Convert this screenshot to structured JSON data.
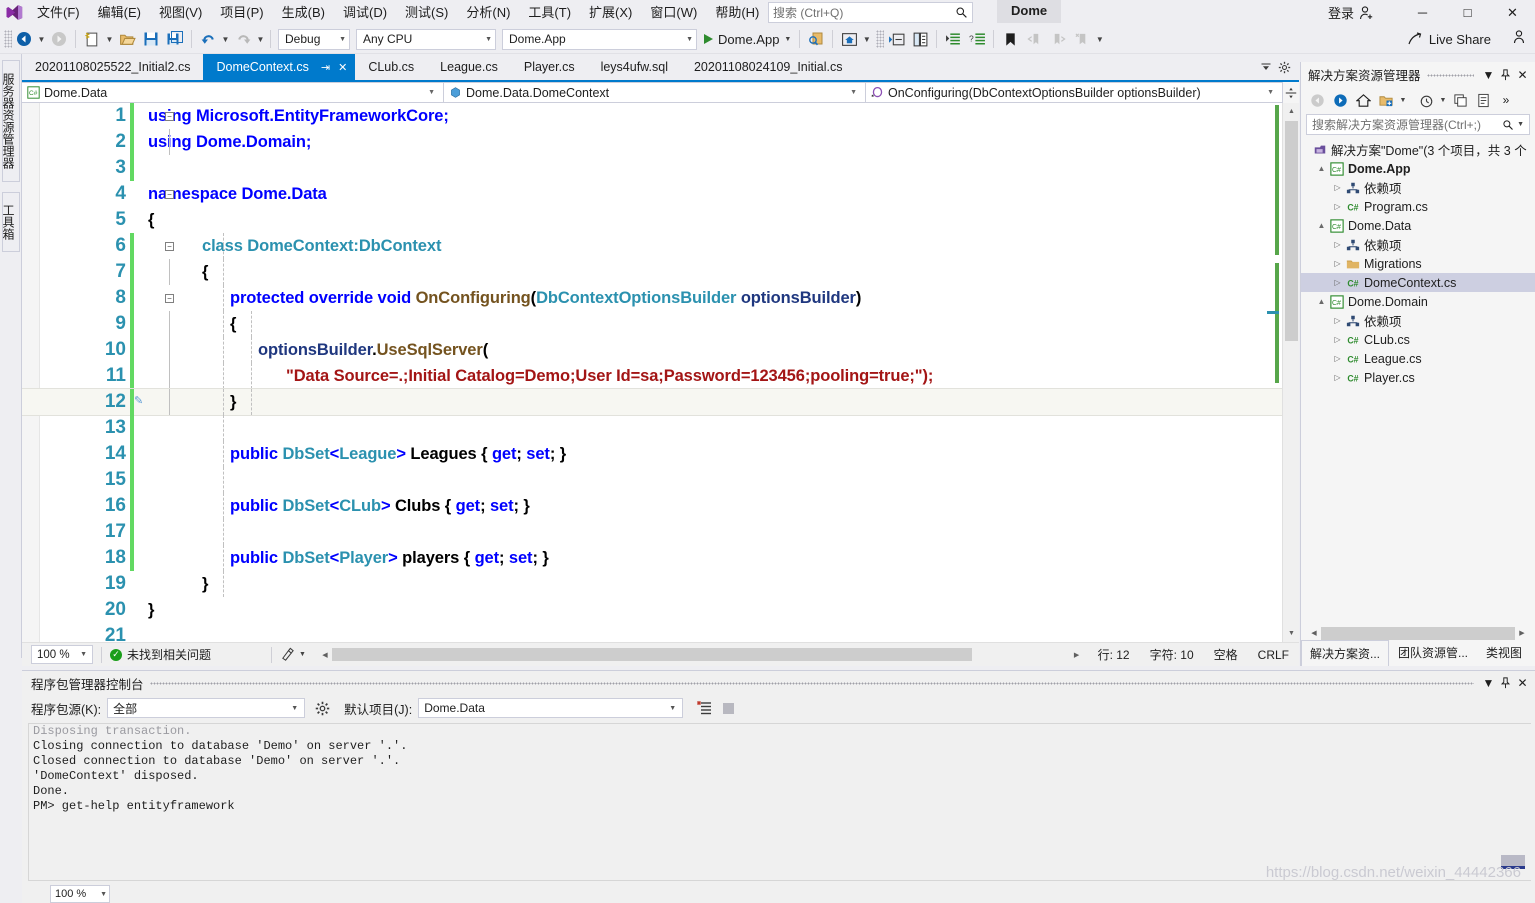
{
  "titlebar": {
    "menus": [
      "文件(F)",
      "编辑(E)",
      "视图(V)",
      "项目(P)",
      "生成(B)",
      "调试(D)",
      "测试(S)",
      "分析(N)",
      "工具(T)",
      "扩展(X)",
      "窗口(W)",
      "帮助(H)"
    ],
    "search_placeholder": "搜索 (Ctrl+Q)",
    "project_chip": "Dome",
    "login_label": "登录",
    "minimize": "─",
    "maximize": "□",
    "close": "✕"
  },
  "toolbar": {
    "config": "Debug",
    "platform": "Any CPU",
    "startup_project": "Dome.App",
    "run_label": "Dome.App",
    "live_share": "Live Share"
  },
  "leftrail": {
    "server_explorer": "服务器资源管理器",
    "toolbox": "工具箱"
  },
  "editor": {
    "tabs": [
      {
        "label": "20201108025522_Initial2.cs",
        "active": false
      },
      {
        "label": "DomeContext.cs",
        "active": true
      },
      {
        "label": "CLub.cs",
        "active": false
      },
      {
        "label": "League.cs",
        "active": false
      },
      {
        "label": "Player.cs",
        "active": false
      },
      {
        "label": "leys4ufw.sql",
        "active": false
      },
      {
        "label": "20201108024109_Initial.cs",
        "active": false
      }
    ],
    "nav_project": "Dome.Data",
    "nav_type": "Dome.Data.DomeContext",
    "nav_member": "OnConfiguring(DbContextOptionsBuilder optionsBuilder)",
    "code_lines": [
      {
        "n": "1",
        "changed": true,
        "collapse": "-",
        "current": false
      },
      {
        "n": "2",
        "changed": true,
        "collapse": "",
        "current": false
      },
      {
        "n": "3",
        "changed": true,
        "collapse": "",
        "current": false
      },
      {
        "n": "4",
        "changed": false,
        "collapse": "-",
        "current": false
      },
      {
        "n": "5",
        "changed": false,
        "collapse": "",
        "current": false
      },
      {
        "n": "6",
        "changed": true,
        "collapse": "-",
        "current": false
      },
      {
        "n": "7",
        "changed": true,
        "collapse": "",
        "current": false
      },
      {
        "n": "8",
        "changed": true,
        "collapse": "-",
        "current": false
      },
      {
        "n": "9",
        "changed": true,
        "collapse": "",
        "current": false
      },
      {
        "n": "10",
        "changed": true,
        "collapse": "",
        "current": false
      },
      {
        "n": "11",
        "changed": true,
        "collapse": "",
        "current": false
      },
      {
        "n": "12",
        "changed": true,
        "collapse": "",
        "current": true
      },
      {
        "n": "13",
        "changed": true,
        "collapse": "",
        "current": false
      },
      {
        "n": "14",
        "changed": true,
        "collapse": "",
        "current": false
      },
      {
        "n": "15",
        "changed": true,
        "collapse": "",
        "current": false
      },
      {
        "n": "16",
        "changed": true,
        "collapse": "",
        "current": false
      },
      {
        "n": "17",
        "changed": true,
        "collapse": "",
        "current": false
      },
      {
        "n": "18",
        "changed": true,
        "collapse": "",
        "current": false
      },
      {
        "n": "19",
        "changed": false,
        "collapse": "",
        "current": false
      },
      {
        "n": "20",
        "changed": false,
        "collapse": "",
        "current": false
      },
      {
        "n": "21",
        "changed": false,
        "collapse": "",
        "current": false
      }
    ],
    "code_text": {
      "l1": "using Microsoft.EntityFrameworkCore;",
      "l2": "using Dome.Domain;",
      "l4": "namespace Dome.Data",
      "l5": "{",
      "l6": "class DomeContext:DbContext",
      "l7": "{",
      "l8": "protected override void OnConfiguring(DbContextOptionsBuilder optionsBuilder)",
      "l9": "{",
      "l10": "optionsBuilder.UseSqlServer(",
      "l11": "\"Data Source=.;Initial Catalog=Demo;User Id=sa;Password=123456;pooling=true;\");",
      "l12": "}",
      "l14": "public DbSet<League> Leagues { get; set; }",
      "l16": "public DbSet<CLub> Clubs { get; set; }",
      "l18": "public DbSet<Player> players { get; set; }",
      "l19": "}",
      "l20": "}"
    },
    "status": {
      "zoom": "100 %",
      "problems": "未找到相关问题",
      "line": "行: 12",
      "column": "字符: 10",
      "spaces": "空格",
      "eol": "CRLF"
    }
  },
  "solution_explorer": {
    "title": "解决方案资源管理器",
    "search_placeholder": "搜索解决方案资源管理器(Ctrl+;)",
    "tree": [
      {
        "indent": 0,
        "arrow": "",
        "icon": "solution",
        "label": "解决方案\"Dome\"(3 个项目，共 3 个",
        "bold": false,
        "selected": false
      },
      {
        "indent": 1,
        "arrow": "▲",
        "icon": "csproj",
        "label": "Dome.App",
        "bold": true,
        "selected": false
      },
      {
        "indent": 2,
        "arrow": "▷",
        "icon": "deps",
        "label": "依赖项",
        "bold": false,
        "selected": false
      },
      {
        "indent": 2,
        "arrow": "▷",
        "icon": "cs",
        "label": "Program.cs",
        "bold": false,
        "selected": false
      },
      {
        "indent": 1,
        "arrow": "▲",
        "icon": "csproj",
        "label": "Dome.Data",
        "bold": false,
        "selected": false
      },
      {
        "indent": 2,
        "arrow": "▷",
        "icon": "deps",
        "label": "依赖项",
        "bold": false,
        "selected": false
      },
      {
        "indent": 2,
        "arrow": "▷",
        "icon": "folder",
        "label": "Migrations",
        "bold": false,
        "selected": false
      },
      {
        "indent": 2,
        "arrow": "▷",
        "icon": "cs",
        "label": "DomeContext.cs",
        "bold": false,
        "selected": true
      },
      {
        "indent": 1,
        "arrow": "▲",
        "icon": "csproj",
        "label": "Dome.Domain",
        "bold": false,
        "selected": false
      },
      {
        "indent": 2,
        "arrow": "▷",
        "icon": "deps",
        "label": "依赖项",
        "bold": false,
        "selected": false
      },
      {
        "indent": 2,
        "arrow": "▷",
        "icon": "cs",
        "label": "CLub.cs",
        "bold": false,
        "selected": false
      },
      {
        "indent": 2,
        "arrow": "▷",
        "icon": "cs",
        "label": "League.cs",
        "bold": false,
        "selected": false
      },
      {
        "indent": 2,
        "arrow": "▷",
        "icon": "cs",
        "label": "Player.cs",
        "bold": false,
        "selected": false
      }
    ],
    "tabs": [
      {
        "label": "解决方案资...",
        "active": true
      },
      {
        "label": "团队资源管...",
        "active": false
      },
      {
        "label": "类视图",
        "active": false
      }
    ]
  },
  "package_console": {
    "title": "程序包管理器控制台",
    "source_label": "程序包源(K):",
    "source_value": "全部",
    "project_label": "默认项目(J):",
    "project_value": "Dome.Data",
    "zoom": "100 %",
    "output": [
      {
        "text": "Disposing transaction.",
        "faded": true
      },
      {
        "text": "Closing connection to database 'Demo' on server '.'.",
        "faded": false
      },
      {
        "text": "Closed connection to database 'Demo' on server '.'.",
        "faded": false
      },
      {
        "text": "'DomeContext' disposed.",
        "faded": false
      },
      {
        "text": "Done.",
        "faded": false
      },
      {
        "text": "PM> get-help entityframework",
        "faded": false
      }
    ]
  },
  "watermark": "https://blog.csdn.net/weixin_44442366"
}
